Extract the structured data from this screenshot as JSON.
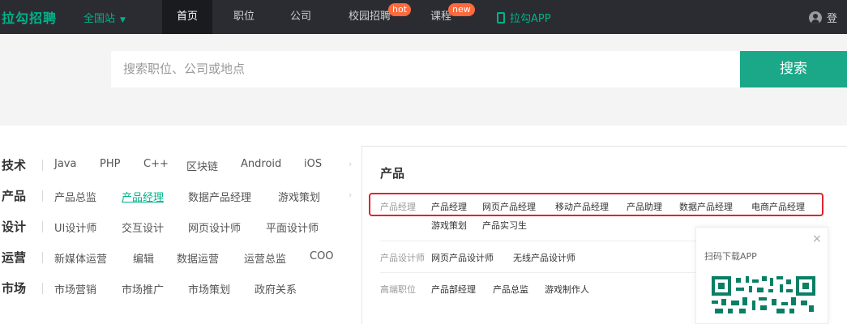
{
  "header": {
    "logo": "拉勾招聘",
    "city": "全国站",
    "nav": [
      {
        "label": "首页"
      },
      {
        "label": "职位"
      },
      {
        "label": "公司"
      },
      {
        "label": "校园招聘",
        "badge": "hot"
      },
      {
        "label": "课程",
        "badge": "new"
      }
    ],
    "app_link": "拉勾APP",
    "login": "登"
  },
  "search": {
    "placeholder": "搜索职位、公司或地点",
    "button": "搜索"
  },
  "categories": [
    {
      "title": "技术",
      "links": [
        "Java",
        "PHP",
        "C++",
        "区块链",
        "Android",
        "iOS"
      ]
    },
    {
      "title": "产品",
      "links": [
        "产品总监",
        "产品经理",
        "数据产品经理",
        "游戏策划"
      ]
    },
    {
      "title": "设计",
      "links": [
        "UI设计师",
        "交互设计",
        "网页设计师",
        "平面设计师"
      ]
    },
    {
      "title": "运营",
      "links": [
        "新媒体运营",
        "编辑",
        "数据运营",
        "运营总监",
        "COO"
      ]
    },
    {
      "title": "市场",
      "links": [
        "市场营销",
        "市场推广",
        "市场策划",
        "政府关系"
      ]
    }
  ],
  "flyout": {
    "title": "产品",
    "groups": [
      {
        "label": "产品经理",
        "links": [
          "产品经理",
          "网页产品经理",
          "移动产品经理",
          "产品助理",
          "数据产品经理",
          "电商产品经理",
          "游戏策划",
          "产品实习生"
        ]
      },
      {
        "label": "产品设计师",
        "links": [
          "网页产品设计师",
          "无线产品设计师"
        ]
      },
      {
        "label": "高端职位",
        "links": [
          "产品部经理",
          "产品总监",
          "游戏制作人"
        ]
      }
    ]
  },
  "qr": {
    "label": "扫码下载APP",
    "close": "×"
  },
  "colors": {
    "brand": "#00b38a",
    "topbar": "#2b2c31",
    "search_button": "#1aa888",
    "highlight_box": "#e0232f",
    "badge": "#ff6a3d"
  }
}
